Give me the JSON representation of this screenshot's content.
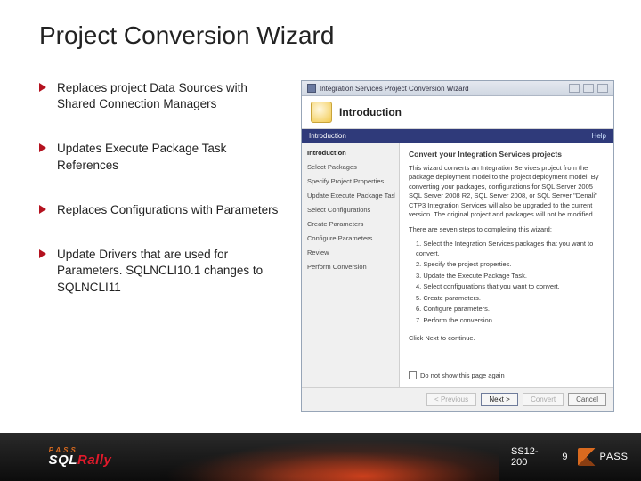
{
  "title": "Project Conversion Wizard",
  "bullets": [
    "Replaces project Data Sources with Shared Connection Managers",
    "Updates Execute Package Task References",
    "Replaces Configurations with Parameters",
    "Update Drivers that are used for Parameters. SQLNCLI10.1 changes to SQLNCLI11"
  ],
  "wizard": {
    "window_title": "Integration Services Project Conversion Wizard",
    "header_title": "Introduction",
    "subbar_left": "Introduction",
    "subbar_help": "Help",
    "nav": [
      "Introduction",
      "Select Packages",
      "Specify Project Properties",
      "Update Execute Package Task",
      "Select Configurations",
      "Create Parameters",
      "Configure Parameters",
      "Review",
      "Perform Conversion"
    ],
    "main_heading": "Convert your Integration Services projects",
    "main_para1": "This wizard converts an Integration Services project from the package deployment model to the project deployment model. By converting your packages, configurations for SQL Server 2005 SQL Server 2008 R2, SQL Server 2008, or SQL Server \"Denali\" CTP3 Integration Services will also be upgraded to the current version. The original project and packages will not be modified.",
    "main_para2": "There are seven steps to completing this wizard:",
    "steps": [
      "1. Select the Integration Services packages that you want to convert.",
      "2. Specify the project properties.",
      "3. Update the Execute Package Task.",
      "4. Select configurations that you want to convert.",
      "5. Create parameters.",
      "6. Configure parameters.",
      "7. Perform the conversion."
    ],
    "click_next": "Click Next to continue.",
    "checkbox_label": "Do not show this page again",
    "buttons": {
      "previous": "< Previous",
      "next": "Next >",
      "convert": "Convert",
      "cancel": "Cancel"
    }
  },
  "footer": {
    "pass": "PASS",
    "brand_sql": "SQL",
    "brand_rally": "Rally",
    "code": "SS12-200",
    "page": "9",
    "pass_right": "PASS"
  }
}
